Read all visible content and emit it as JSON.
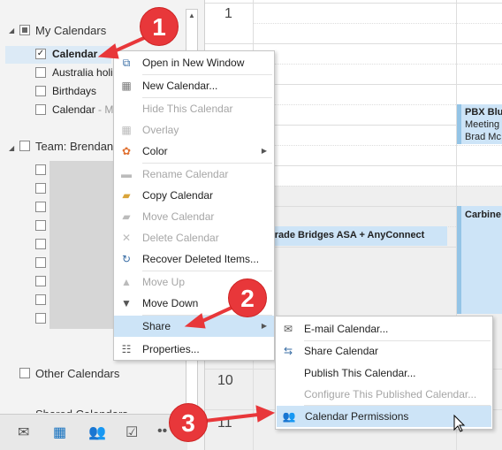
{
  "sidebar": {
    "my_calendars": "My Calendars",
    "items": [
      {
        "label": "Calendar",
        "checked": true,
        "suffix": " -"
      },
      {
        "label": "Australia holi",
        "checked": false
      },
      {
        "label": "Birthdays",
        "checked": false
      },
      {
        "label": "Calendar",
        "suffix": " - M",
        "checked": false
      }
    ],
    "team": "Team: Brendan",
    "other": "Other Calendars",
    "shared": "Shared Calendars"
  },
  "nav": {
    "icons": [
      "mail-icon",
      "calendar-icon",
      "people-icon",
      "tasks-icon",
      "more-icon"
    ],
    "more": "••",
    "active_color": "#106ebe"
  },
  "calendar": {
    "hours": [
      "1",
      "10",
      "11"
    ],
    "events": [
      {
        "lines": [
          "PBX Blue",
          "Meeting",
          "Brad Mc"
        ]
      },
      {
        "title": "grade Bridges ASA + AnyConnect"
      },
      {
        "title": "Carbine"
      }
    ]
  },
  "context_menu": {
    "items": [
      {
        "label": "Open in New Window",
        "icon": "open-window-icon"
      },
      {
        "label": "New Calendar...",
        "icon": "new-calendar-icon"
      },
      {
        "label": "Hide This Calendar",
        "disabled": true
      },
      {
        "label": "Overlay",
        "icon": "overlay-icon",
        "disabled": true
      },
      {
        "label": "Color",
        "icon": "color-icon",
        "submenu": true
      },
      {
        "label": "Rename Calendar",
        "icon": "rename-icon",
        "disabled": true
      },
      {
        "label": "Copy Calendar",
        "icon": "copy-icon"
      },
      {
        "label": "Move Calendar",
        "icon": "move-icon",
        "disabled": true
      },
      {
        "label": "Delete Calendar",
        "icon": "delete-icon",
        "disabled": true
      },
      {
        "label": "Recover Deleted Items...",
        "icon": "recover-icon"
      },
      {
        "label": "Move Up",
        "icon": "up-icon",
        "disabled": true
      },
      {
        "label": "Move Down",
        "icon": "down-icon"
      },
      {
        "label": "Share",
        "submenu": true,
        "highlighted": true
      },
      {
        "label": "Properties...",
        "icon": "properties-icon"
      }
    ]
  },
  "share_menu": {
    "items": [
      {
        "label": "E-mail Calendar...",
        "icon": "email-calendar-icon"
      },
      {
        "label": "Share Calendar",
        "icon": "share-calendar-icon"
      },
      {
        "label": "Publish This Calendar..."
      },
      {
        "label": "Configure This Published Calendar...",
        "disabled": true
      },
      {
        "label": "Calendar Permissions",
        "icon": "permissions-icon",
        "highlighted": true
      }
    ]
  },
  "annotations": [
    "1",
    "2",
    "3"
  ],
  "colors": {
    "highlight": "#cde4f7",
    "annotation": "#e8373a"
  }
}
